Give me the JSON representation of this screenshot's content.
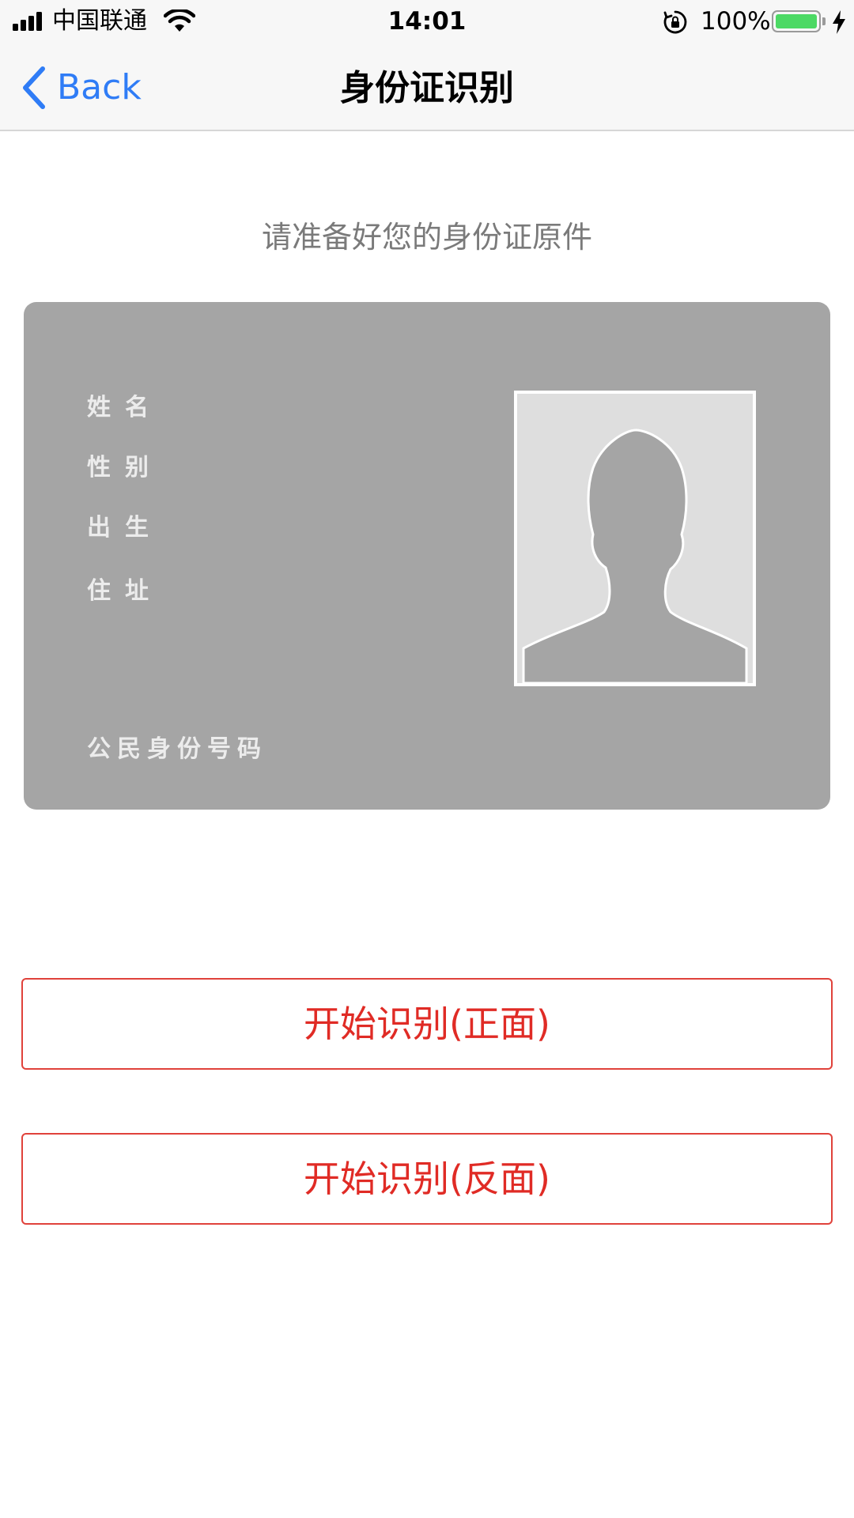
{
  "status_bar": {
    "carrier": "中国联通",
    "time": "14:01",
    "battery_percent": "100%",
    "battery_level": 1.0,
    "battery_color": "#4cd964"
  },
  "nav": {
    "back_label": "Back",
    "title": "身份证识别"
  },
  "content": {
    "prompt": "请准备好您的身份证原件",
    "card": {
      "name_label": "姓名",
      "gender_label": "性别",
      "birth_label": "出生",
      "address_label": "住址",
      "id_number_label": "公民身份号码"
    }
  },
  "buttons": {
    "scan_front": "开始识别(正面)",
    "scan_back": "开始识别(反面)"
  },
  "colors": {
    "accent_blue": "#2f7cf6",
    "action_red": "#e02b25",
    "card_gray": "#a5a5a5"
  }
}
